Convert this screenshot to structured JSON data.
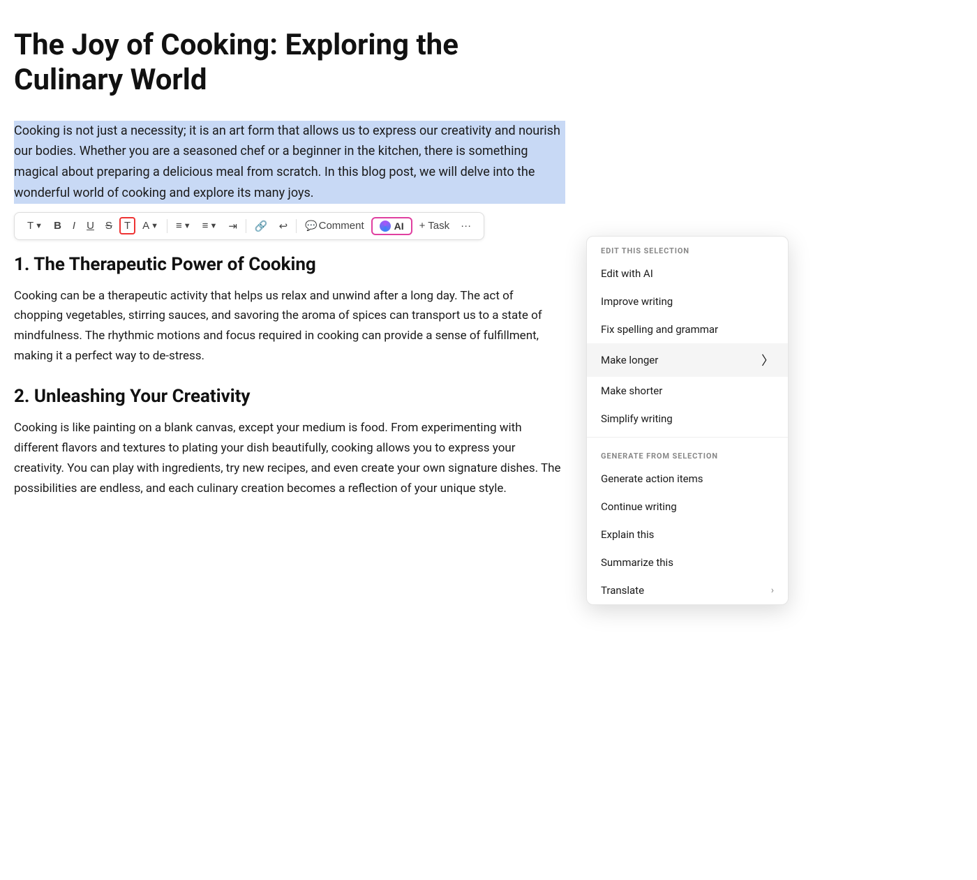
{
  "document": {
    "title": "The Joy of Cooking: Exploring the Culinary World",
    "selected_paragraph": "Cooking is not just a necessity; it is an art form that allows us to express our creativity and nourish our bodies. Whether you are a seasoned chef or a beginner in the kitchen, there is something magical about preparing a delicious meal from scratch. In this blog post, we will delve into the wonderful world of cooking and explore its many joys.",
    "section1": {
      "heading": "1. The Therapeutic Power of Cooking",
      "body": "Cooking can be a therapeutic activity that helps us relax and unwind after a long day. The act of chopping vegetables, stirring sauces, and savoring the aroma of spices can transport us to a state of mindfulness. The rhythmic motions and focus required in cooking can provide a sense of fulfillment, making it a perfect way to de-stress."
    },
    "section2": {
      "heading": "2. Unleashing Your Creativity",
      "body": "Cooking is like painting on a blank canvas, except your medium is food. From experimenting with different flavors and textures to plating your dish beautifully, cooking allows you to express your creativity. You can play with ingredients, try new recipes, and even create your own signature dishes. The possibilities are endless, and each culinary creation becomes a reflection of your unique style."
    }
  },
  "toolbar": {
    "text_label": "T",
    "bold_label": "B",
    "italic_label": "I",
    "underline_label": "U",
    "strikethrough_label": "S",
    "color_label": "T",
    "font_color_label": "A",
    "align_label": "≡",
    "list_label": "≡",
    "indent_label": "⇥",
    "link_label": "🔗",
    "undo_label": "↩",
    "comment_label": "Comment",
    "ai_label": "AI",
    "task_label": "+ Task",
    "more_label": "···"
  },
  "ai_dropdown": {
    "edit_section_label": "EDIT THIS SELECTION",
    "generate_section_label": "GENERATE FROM SELECTION",
    "items_edit": [
      {
        "id": "edit-with-ai",
        "label": "Edit with AI",
        "has_arrow": false
      },
      {
        "id": "improve-writing",
        "label": "Improve writing",
        "has_arrow": false
      },
      {
        "id": "fix-spelling",
        "label": "Fix spelling and grammar",
        "has_arrow": false
      },
      {
        "id": "make-longer",
        "label": "Make longer",
        "has_arrow": false,
        "hovered": true
      },
      {
        "id": "make-shorter",
        "label": "Make shorter",
        "has_arrow": false
      },
      {
        "id": "simplify-writing",
        "label": "Simplify writing",
        "has_arrow": false
      }
    ],
    "items_generate": [
      {
        "id": "generate-action-items",
        "label": "Generate action items",
        "has_arrow": false
      },
      {
        "id": "continue-writing",
        "label": "Continue writing",
        "has_arrow": false
      },
      {
        "id": "explain-this",
        "label": "Explain this",
        "has_arrow": false
      },
      {
        "id": "summarize-this",
        "label": "Summarize this",
        "has_arrow": false
      },
      {
        "id": "translate",
        "label": "Translate",
        "has_arrow": true
      }
    ]
  }
}
